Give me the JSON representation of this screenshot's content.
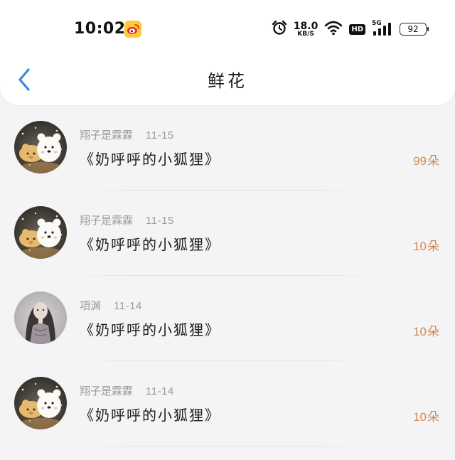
{
  "status_bar": {
    "time": "10:02",
    "net_speed_value": "18.0",
    "net_speed_unit": "KB/S",
    "hd_label": "HD",
    "network_type": "5G",
    "battery": "92",
    "icons": [
      "weibo-app-icon",
      "alarm-icon",
      "wifi-icon",
      "signal-icon",
      "battery-icon"
    ]
  },
  "header": {
    "title": "鲜花",
    "back_icon": "chevron-left-icon"
  },
  "colors": {
    "accent_blue": "#2f8be0",
    "count_orange": "#d48a4a",
    "meta_gray": "#9a9a9a"
  },
  "records": [
    {
      "sender": "翔子是霖霖",
      "date": "11-15",
      "gift_name": "《奶呼呼的小狐狸》",
      "count": "99",
      "unit": "朵",
      "avatar": "bear-avatar"
    },
    {
      "sender": "翔子是霖霖",
      "date": "11-15",
      "gift_name": "《奶呼呼的小狐狸》",
      "count": "10",
      "unit": "朵",
      "avatar": "bear-avatar"
    },
    {
      "sender": "項渊",
      "date": "11-14",
      "gift_name": "《奶呼呼的小狐狸》",
      "count": "10",
      "unit": "朵",
      "avatar": "photo-avatar"
    },
    {
      "sender": "翔子是霖霖",
      "date": "11-14",
      "gift_name": "《奶呼呼的小狐狸》",
      "count": "10",
      "unit": "朵",
      "avatar": "bear-avatar"
    }
  ]
}
